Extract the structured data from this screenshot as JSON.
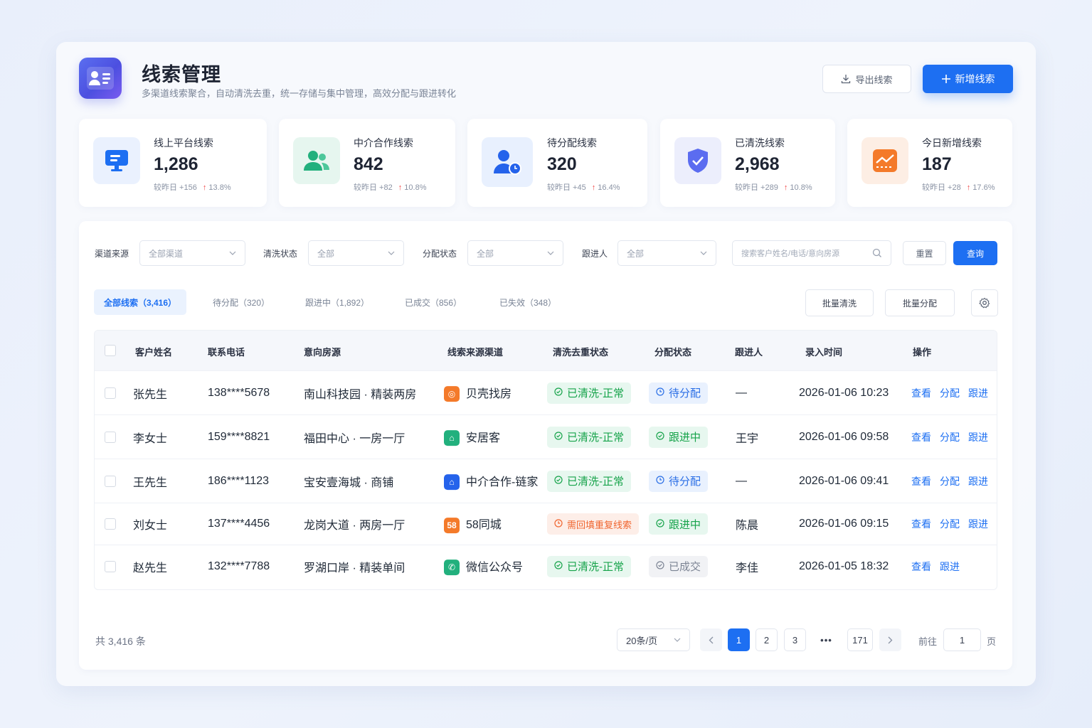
{
  "header": {
    "title": "线索管理",
    "subtitle": "多渠道线索聚合，自动清洗去重，统一存储与集中管理，高效分配与跟进转化",
    "export_label": "导出线索",
    "new_label": "新增线索"
  },
  "stats": [
    {
      "label": "线上平台线索",
      "value": "1,286",
      "cmp": "较昨日 +156",
      "pct": "13.8%",
      "color": "#1d6ff2",
      "icon": "monitor-icon"
    },
    {
      "label": "中介合作线索",
      "value": "842",
      "cmp": "较昨日 +82",
      "pct": "10.8%",
      "color": "#22b07d",
      "icon": "users-icon"
    },
    {
      "label": "待分配线索",
      "value": "320",
      "cmp": "较昨日 +45",
      "pct": "16.4%",
      "color": "#2563eb",
      "icon": "user-clock-icon"
    },
    {
      "label": "已清洗线索",
      "value": "2,968",
      "cmp": "较昨日 +289",
      "pct": "10.8%",
      "color": "#5b6cf0",
      "icon": "shield-check-icon"
    },
    {
      "label": "今日新增线索",
      "value": "187",
      "cmp": "较昨日 +28",
      "pct": "17.6%",
      "color": "#f47a2a",
      "icon": "trend-chart-icon"
    }
  ],
  "filters": {
    "channel": {
      "label": "渠道来源",
      "value": "全部渠道"
    },
    "clean": {
      "label": "清洗状态",
      "value": "全部"
    },
    "assign": {
      "label": "分配状态",
      "value": "全部"
    },
    "follower": {
      "label": "跟进人",
      "value": "全部"
    },
    "search_placeholder": "搜索客户姓名/电话/意向房源",
    "reset_label": "重置",
    "query_label": "查询"
  },
  "tabs": [
    {
      "label": "全部线索（3,416）"
    },
    {
      "label": "待分配（320）"
    },
    {
      "label": "跟进中（1,892）"
    },
    {
      "label": "已成交（856）"
    },
    {
      "label": "已失效（348）"
    }
  ],
  "batch": {
    "clean_label": "批量清洗",
    "assign_label": "批量分配"
  },
  "table": {
    "columns": [
      "客户姓名",
      "联系电话",
      "意向房源",
      "线索来源渠道",
      "清洗去重状态",
      "分配状态",
      "跟进人",
      "录入时间",
      "操作"
    ],
    "rows": [
      {
        "name": "张先生",
        "phone": "138****5678",
        "house": "南山科技园 · 精装两房",
        "channel": "贝壳找房",
        "channel_color": "#f47a2a",
        "channel_glyph": "◎",
        "clean": "已清洗-正常",
        "clean_type": "green",
        "assign": "待分配",
        "assign_type": "blue",
        "follower": "—",
        "time": "2026-01-06 10:23",
        "ops": [
          "查看",
          "分配",
          "跟进"
        ]
      },
      {
        "name": "李女士",
        "phone": "159****8821",
        "house": "福田中心 · 一房一厅",
        "channel": "安居客",
        "channel_color": "#22b07d",
        "channel_glyph": "⌂",
        "clean": "已清洗-正常",
        "clean_type": "green",
        "assign": "跟进中",
        "assign_type": "green",
        "follower": "王宇",
        "time": "2026-01-06 09:58",
        "ops": [
          "查看",
          "分配",
          "跟进"
        ]
      },
      {
        "name": "王先生",
        "phone": "186****1123",
        "house": "宝安壹海城 · 商铺",
        "channel": "中介合作-链家",
        "channel_color": "#2563eb",
        "channel_glyph": "⌂",
        "clean": "已清洗-正常",
        "clean_type": "green",
        "assign": "待分配",
        "assign_type": "blue",
        "follower": "—",
        "time": "2026-01-06 09:41",
        "ops": [
          "查看",
          "分配",
          "跟进"
        ]
      },
      {
        "name": "刘女士",
        "phone": "137****4456",
        "house": "龙岗大道 · 两房一厅",
        "channel": "58同城",
        "channel_color": "#f47a2a",
        "channel_glyph": "58",
        "clean": "需回填重复线索",
        "clean_type": "orange",
        "assign": "跟进中",
        "assign_type": "green",
        "follower": "陈晨",
        "time": "2026-01-06 09:15",
        "ops": [
          "查看",
          "分配",
          "跟进"
        ]
      },
      {
        "name": "赵先生",
        "phone": "132****7788",
        "house": "罗湖口岸 · 精装单间",
        "channel": "微信公众号",
        "channel_color": "#22b07d",
        "channel_glyph": "✆",
        "clean": "已清洗-正常",
        "clean_type": "green",
        "assign": "已成交",
        "assign_type": "gray",
        "follower": "李佳",
        "time": "2026-01-05 18:32",
        "ops": [
          "查看",
          "跟进"
        ]
      }
    ]
  },
  "pagination": {
    "total": "共 3,416 条",
    "page_size": "20条/页",
    "pages": [
      "1",
      "2",
      "3",
      "•••",
      "171"
    ],
    "current": "1",
    "goto_prefix": "前往",
    "goto_value": "1",
    "goto_suffix": "页"
  }
}
